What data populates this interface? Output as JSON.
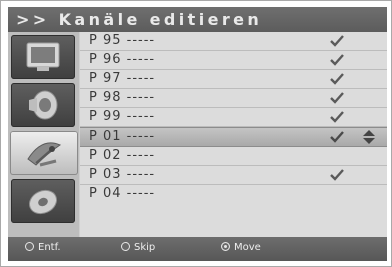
{
  "header": {
    "title": ">> Kanäle editieren"
  },
  "sidebar": {
    "items": [
      {
        "icon": "tv-icon",
        "active": false
      },
      {
        "icon": "speaker-icon",
        "active": false
      },
      {
        "icon": "satellite-dish-icon",
        "active": true
      },
      {
        "icon": "disc-icon",
        "active": false
      }
    ]
  },
  "list": {
    "rows": [
      {
        "label": "P 95 -----",
        "checked": true
      },
      {
        "label": "P 96 -----",
        "checked": true
      },
      {
        "label": "P 97 -----",
        "checked": true
      },
      {
        "label": "P 98 -----",
        "checked": true
      },
      {
        "label": "P 99 -----",
        "checked": true
      },
      {
        "label": "P 01 -----",
        "checked": true,
        "selected": true
      },
      {
        "label": "P 02 -----",
        "checked": false
      },
      {
        "label": "P 03 -----",
        "checked": true
      },
      {
        "label": "P 04 -----",
        "checked": false
      }
    ]
  },
  "footer": {
    "entf_label": "Entf.",
    "skip_label": "Skip",
    "move_label": "Move"
  },
  "colors": {
    "header_bg": "#5f5f5f",
    "list_bg": "#dcdcdc",
    "selected_bg": "#b3b3b3",
    "check": "#5a5a5a"
  }
}
